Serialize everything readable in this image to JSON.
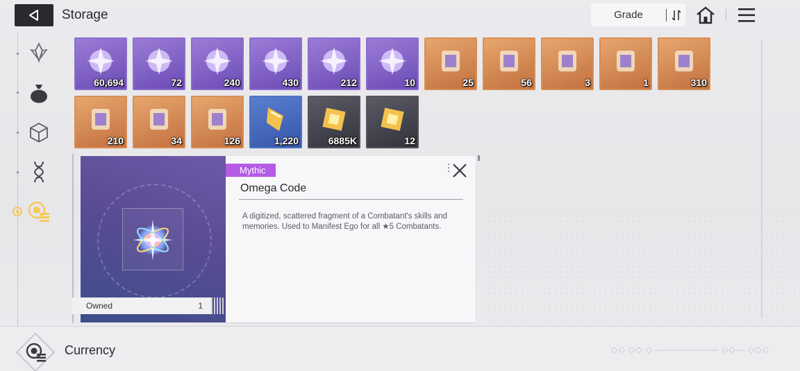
{
  "header": {
    "title": "Storage",
    "sort_label": "Grade"
  },
  "sidebar": {
    "items": [
      {
        "name": "crystal",
        "icon": "crystal-icon"
      },
      {
        "name": "pouch",
        "icon": "pouch-icon"
      },
      {
        "name": "cube",
        "icon": "cube-icon"
      },
      {
        "name": "dna",
        "icon": "dna-icon"
      },
      {
        "name": "currency",
        "icon": "currency-coin-icon",
        "active": true
      }
    ]
  },
  "items": [
    {
      "qty": "60,694",
      "rarity": "purple",
      "icon": "star-crystal-icon"
    },
    {
      "qty": "72",
      "rarity": "purple",
      "icon": "orb-ring-icon"
    },
    {
      "qty": "240",
      "rarity": "purple",
      "icon": "orange-orb-ring-icon"
    },
    {
      "qty": "430",
      "rarity": "purple",
      "icon": "green-cube-icon"
    },
    {
      "qty": "212",
      "rarity": "purple",
      "icon": "camera-icon"
    },
    {
      "qty": "10",
      "rarity": "purple",
      "icon": "medal-coin-icon"
    },
    {
      "qty": "25",
      "rarity": "orange",
      "icon": "hourglass-icon"
    },
    {
      "qty": "56",
      "rarity": "orange",
      "icon": "ribbon-icon"
    },
    {
      "qty": "3",
      "rarity": "orange",
      "icon": "card-icon"
    },
    {
      "qty": "1",
      "rarity": "orange",
      "icon": "device-icon"
    },
    {
      "qty": "310",
      "rarity": "orange",
      "icon": "purple-flower-icon"
    },
    {
      "qty": "210",
      "rarity": "orange",
      "icon": "purple-chest-icon"
    },
    {
      "qty": "34",
      "rarity": "orange",
      "icon": "purple-chest-small-icon"
    },
    {
      "qty": "126",
      "rarity": "orange",
      "icon": "dark-gear-orb-icon"
    },
    {
      "qty": "1,220",
      "rarity": "blue",
      "icon": "gold-ribbon-icon"
    },
    {
      "qty": "6885K",
      "rarity": "dark",
      "icon": "gold-gem-icon"
    },
    {
      "qty": "12",
      "rarity": "dark",
      "icon": "canister-icon"
    }
  ],
  "detail": {
    "rarity": "Mythic",
    "name": "Omega Code",
    "description": "A digitized, scattered fragment of a Combatant's skills and memories. Used to Manifest Ego for all ★5 Combatants.",
    "owned_label": "Owned",
    "owned_value": "1"
  },
  "footer": {
    "title": "Currency"
  },
  "colors": {
    "mythic": "#b55ce6",
    "active": "#f7c85a"
  }
}
